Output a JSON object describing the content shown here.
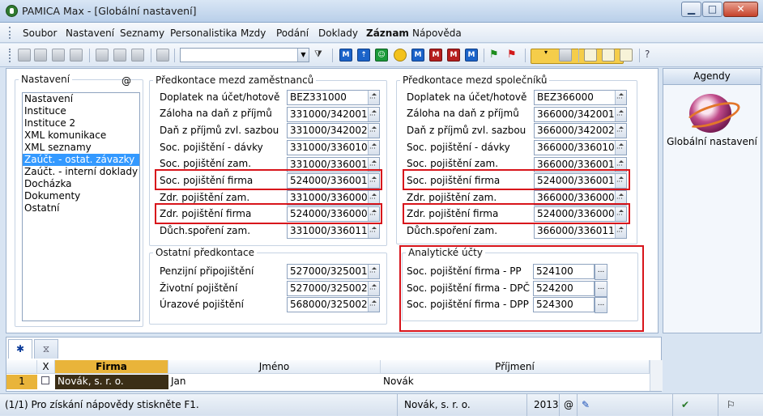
{
  "window": {
    "title": "PAMICA Max - [Globální nastavení]",
    "btn_min": "▁",
    "btn_max": "□",
    "btn_close": "✕"
  },
  "menu": [
    "Soubor",
    "Nastavení",
    "Seznamy",
    "Personalistika",
    "Mzdy",
    "Podání",
    "Doklady",
    "Záznam",
    "Nápověda"
  ],
  "toolbar": {
    "combo_value": ""
  },
  "settings": {
    "group_label": "Nastavení",
    "at_symbol": "@",
    "items": [
      "Nastavení",
      "Instituce",
      "Instituce 2",
      "XML komunikace",
      "XML seznamy",
      "Zaúčt. - ostat. závazky",
      "Zaúčt. - interní doklady",
      "Docházka",
      "Dokumenty",
      "Ostatní"
    ],
    "selected_index": 5
  },
  "employees": {
    "legend": "Předkontace mezd zaměstnanců",
    "rows": [
      {
        "label": "Doplatek na účet/hotově",
        "value": "BEZ331000"
      },
      {
        "label": "Záloha na daň z příjmů",
        "value": "331000/342001"
      },
      {
        "label": "Daň z příjmů zvl. sazbou",
        "value": "331000/342002"
      },
      {
        "label": "Soc. pojištění - dávky",
        "value": "331000/336010"
      },
      {
        "label": "Soc. pojištění zam.",
        "value": "331000/336001"
      },
      {
        "label": "Soc. pojištění firma",
        "value": "524000/336001"
      },
      {
        "label": "Zdr. pojištění zam.",
        "value": "331000/336000"
      },
      {
        "label": "Zdr. pojištění firma",
        "value": "524000/336000"
      },
      {
        "label": "Důch.spoření zam.",
        "value": "331000/336011"
      }
    ]
  },
  "other": {
    "legend": "Ostatní předkontace",
    "rows": [
      {
        "label": "Penzijní připojištění",
        "value": "527000/325001"
      },
      {
        "label": "Životní pojištění",
        "value": "527000/325002"
      },
      {
        "label": "Úrazové pojištění",
        "value": "568000/325002"
      }
    ]
  },
  "company": {
    "legend": "Předkontace mezd společníků",
    "rows": [
      {
        "label": "Doplatek na účet/hotově",
        "value": "BEZ366000"
      },
      {
        "label": "Záloha na daň z příjmů",
        "value": "366000/342001"
      },
      {
        "label": "Daň z příjmů zvl. sazbou",
        "value": "366000/342002"
      },
      {
        "label": "Soc. pojištění - dávky",
        "value": "366000/336010"
      },
      {
        "label": "Soc. pojištění zam.",
        "value": "366000/336001"
      },
      {
        "label": "Soc. pojištění firma",
        "value": "524000/336001"
      },
      {
        "label": "Zdr. pojištění zam.",
        "value": "366000/336000"
      },
      {
        "label": "Zdr. pojištění firma",
        "value": "524000/336000"
      },
      {
        "label": "Důch.spoření zam.",
        "value": "366000/336011"
      }
    ]
  },
  "analytic": {
    "legend": "Analytické účty",
    "rows": [
      {
        "label": "Soc. pojištění firma - PP",
        "value": "524100"
      },
      {
        "label": "Soc. pojištění firma - DPČ",
        "value": "524200"
      },
      {
        "label": "Soc. pojištění firma - DPP",
        "value": "524300"
      }
    ],
    "button_label": "..."
  },
  "agendy": {
    "title": "Agendy",
    "label": "Globální nastavení"
  },
  "grid": {
    "tab_new": "✱",
    "tab_filter": "⧖",
    "columns": {
      "x": "X",
      "firma": "Firma",
      "jmeno": "Jméno",
      "prijmeni": "Příjmení"
    },
    "row": {
      "num": "1",
      "firma": "Novák, s. r. o.",
      "jmeno": "Jan",
      "prijmeni": "Novák"
    }
  },
  "status": {
    "help": "(1/1) Pro získání nápovědy stiskněte F1.",
    "company": "Novák, s. r. o.",
    "year": "2013",
    "at": "@"
  }
}
